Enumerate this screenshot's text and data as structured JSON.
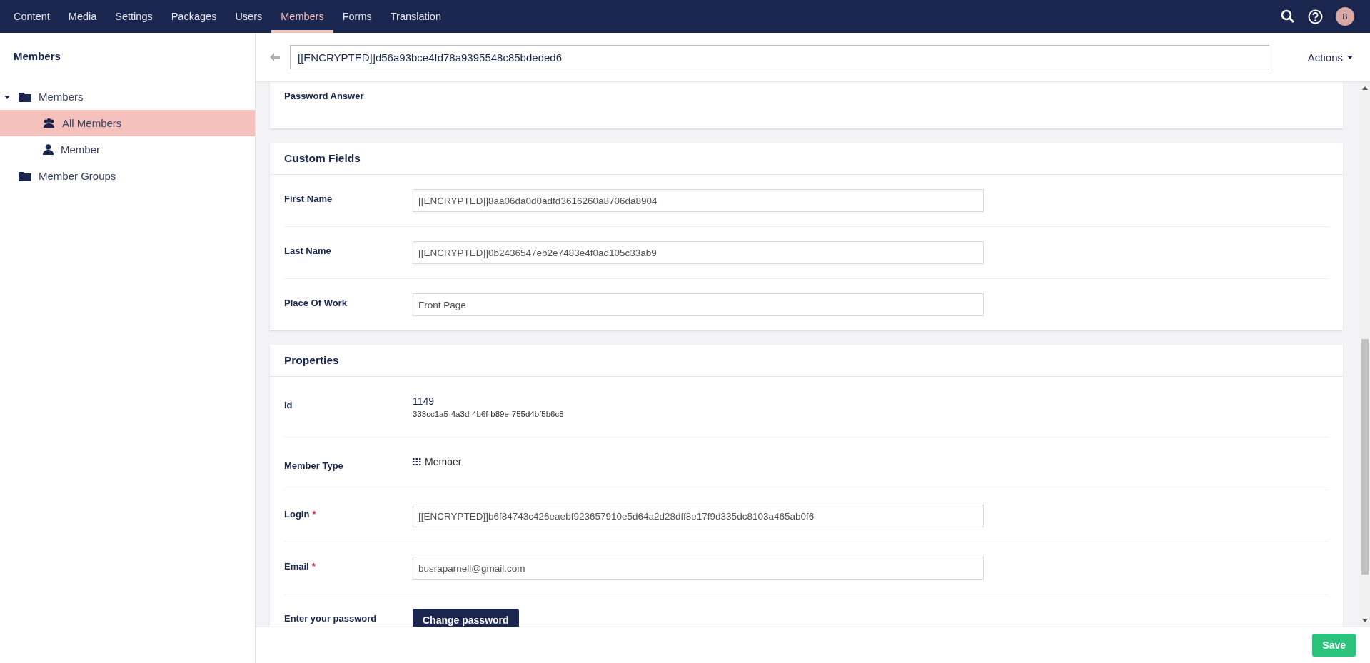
{
  "top_nav": {
    "sections": [
      {
        "label": "Content",
        "selected": false
      },
      {
        "label": "Media",
        "selected": false
      },
      {
        "label": "Settings",
        "selected": false
      },
      {
        "label": "Packages",
        "selected": false
      },
      {
        "label": "Users",
        "selected": false
      },
      {
        "label": "Members",
        "selected": true
      },
      {
        "label": "Forms",
        "selected": false
      },
      {
        "label": "Translation",
        "selected": false
      }
    ],
    "avatar_initial": "B"
  },
  "sidebar": {
    "title": "Members",
    "tree": [
      {
        "label": "Members",
        "kind": "folder",
        "expanded": true,
        "selected": false,
        "children": [
          {
            "label": "All Members",
            "kind": "users",
            "selected": true
          },
          {
            "label": "Member",
            "kind": "user",
            "selected": false
          }
        ]
      },
      {
        "label": "Member Groups",
        "kind": "folder",
        "selected": false
      }
    ]
  },
  "editor": {
    "name_value": "[[ENCRYPTED]]d56a93bce4fd78a9395548c85bdeded6",
    "actions_label": "Actions",
    "panels": [
      {
        "rows": [
          {
            "kind": "empty",
            "label": "Password Answer"
          }
        ]
      },
      {
        "title": "Custom Fields",
        "rows": [
          {
            "kind": "input",
            "label": "First Name",
            "value": "[[ENCRYPTED]]8aa06da0d0adfd3616260a8706da8904"
          },
          {
            "kind": "input",
            "label": "Last Name",
            "value": "[[ENCRYPTED]]0b2436547eb2e7483e4f0ad105c33ab9"
          },
          {
            "kind": "input",
            "label": "Place Of Work",
            "value": "Front Page"
          }
        ]
      },
      {
        "title": "Properties",
        "rows": [
          {
            "kind": "id",
            "label": "Id",
            "value": "1149",
            "sub": "333cc1a5-4a3d-4b6f-b89e-755d4bf5b6c8"
          },
          {
            "kind": "type",
            "label": "Member Type",
            "value": "Member"
          },
          {
            "kind": "input",
            "label": "Login",
            "required_mark": "*",
            "value": "[[ENCRYPTED]]b6f84743c426eaebf923657910e5d64a2d28dff8e17f9d335dc8103a465ab0f6"
          },
          {
            "kind": "input",
            "label": "Email",
            "required_mark": "*",
            "value": "busraparnell@gmail.com"
          },
          {
            "kind": "button",
            "label": "Enter your password",
            "value": "Change password"
          }
        ]
      }
    ]
  },
  "footer": {
    "save_label": "Save"
  }
}
